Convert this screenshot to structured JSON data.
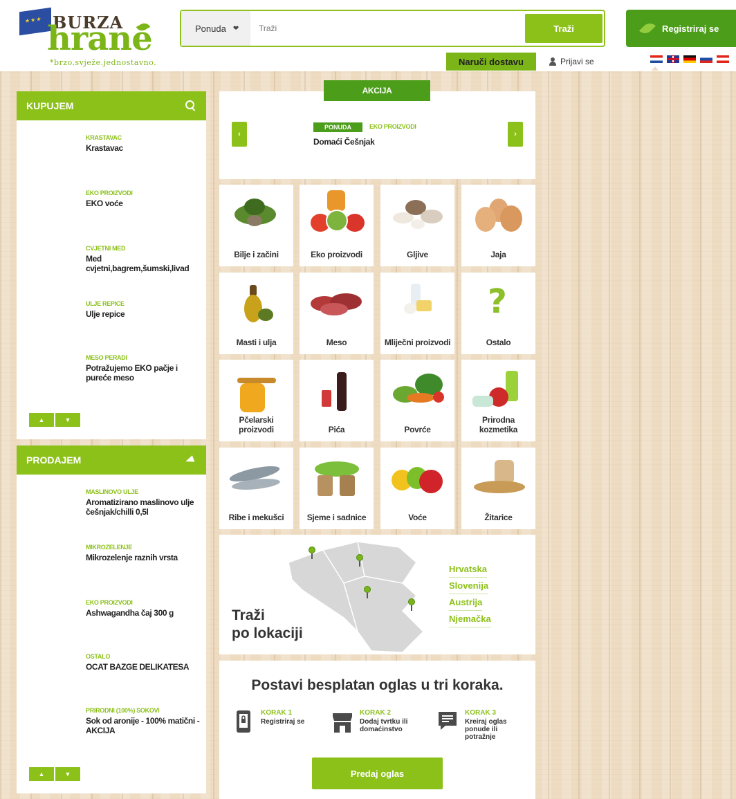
{
  "logo": {
    "top": "BURZA",
    "main": "hrane",
    "tagline": "*brzo.svježe.jednostavno."
  },
  "search": {
    "category": "Ponuda",
    "placeholder": "Traži",
    "button": "Traži"
  },
  "header": {
    "register": "Registriraj se",
    "order": "Naruči dostavu",
    "login": "Prijavi se",
    "flags": [
      "croatia-flag-icon",
      "uk-flag-icon",
      "germany-flag-icon",
      "slovenia-flag-icon",
      "austria-flag-icon"
    ]
  },
  "kupujem": {
    "title": "KUPUJEM",
    "items": [
      {
        "category": "KRASTAVAC",
        "title": "Krastavac"
      },
      {
        "category": "EKO PROIZVODI",
        "title": "EKO voće"
      },
      {
        "category": "CVJETNI MED",
        "title": "Med cvjetni,bagrem,šumski,livad"
      },
      {
        "category": "ULJE REPICE",
        "title": "Ulje repice"
      },
      {
        "category": "MESO PERADI",
        "title": "Potražujemo EKO pačje i pureće meso"
      }
    ]
  },
  "prodajem": {
    "title": "PRODAJEM",
    "items": [
      {
        "category": "MASLINOVO ULJE",
        "title": "Aromatizirano maslinovo ulje češnjak/chilli 0,5l"
      },
      {
        "category": "MIKROZELENJE",
        "title": "Mikrozelenje raznih vrsta"
      },
      {
        "category": "EKO PROIZVODI",
        "title": "Ashwagandha čaj 300 g"
      },
      {
        "category": "OSTALO",
        "title": "OCAT BAZGE DELIKATESA"
      },
      {
        "category": "PRIRODNI (100%) SOKOVI",
        "title": "Sok od aronije - 100% matični - AKCIJA"
      }
    ]
  },
  "akcija": {
    "tab": "AKCIJA",
    "badge": "PONUDA",
    "category": "EKO PROIZVODI",
    "title": "Domaći Češnjak",
    "prev": "‹",
    "next": "›"
  },
  "categories": [
    {
      "label": "Bilje i začini",
      "icon": "herbs-icon"
    },
    {
      "label": "Eko proizvodi",
      "icon": "eco-products-icon"
    },
    {
      "label": "Gljive",
      "icon": "mushrooms-icon"
    },
    {
      "label": "Jaja",
      "icon": "eggs-icon"
    },
    {
      "label": "Masti i ulja",
      "icon": "oil-icon"
    },
    {
      "label": "Meso",
      "icon": "meat-icon"
    },
    {
      "label": "Mliječni proizvodi",
      "icon": "dairy-icon"
    },
    {
      "label": "Ostalo",
      "icon": "question-icon"
    },
    {
      "label": "Pčelarski proizvodi",
      "icon": "honey-icon"
    },
    {
      "label": "Pića",
      "icon": "drinks-icon"
    },
    {
      "label": "Povrće",
      "icon": "vegetables-icon"
    },
    {
      "label": "Prirodna kozmetika",
      "icon": "cosmetics-icon"
    },
    {
      "label": "Ribe i mekušci",
      "icon": "fish-icon"
    },
    {
      "label": "Sjeme i sadnice",
      "icon": "seedlings-icon"
    },
    {
      "label": "Voće",
      "icon": "fruit-icon"
    },
    {
      "label": "Žitarice",
      "icon": "grain-icon"
    }
  ],
  "location": {
    "title_line1": "Traži",
    "title_line2": "po lokaciji",
    "countries": [
      "Hrvatska",
      "Slovenija",
      "Austrija",
      "Njemačka"
    ]
  },
  "steps": {
    "title": "Postavi besplatan oglas u tri koraka.",
    "items": [
      {
        "label": "KORAK 1",
        "desc": "Registriraj se",
        "icon": "phone-icon"
      },
      {
        "label": "KORAK 2",
        "desc": "Dodaj tvrtku ili domaćinstvo",
        "icon": "store-icon"
      },
      {
        "label": "KORAK 3",
        "desc": "Kreiraj oglas ponude ili potražnje",
        "icon": "chat-icon"
      }
    ],
    "button": "Predaj oglas"
  },
  "colors": {
    "accent": "#8cc11a",
    "dark_green": "#4c9d1a"
  }
}
